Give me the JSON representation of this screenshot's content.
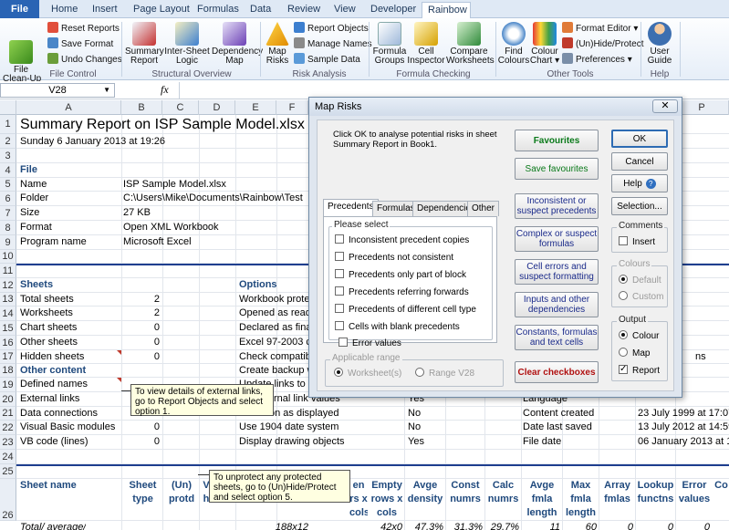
{
  "ribbon": {
    "tabs": [
      "File",
      "Home",
      "Insert",
      "Page Layout",
      "Formulas",
      "Data",
      "Review",
      "View",
      "Developer",
      "Rainbow"
    ],
    "active_tab": "Rainbow",
    "buttons": {
      "file_cleanup": "File\nClean-Up",
      "reset_reports": "Reset Reports",
      "save_format": "Save Format",
      "undo_changes": "Undo Changes",
      "summary_report": "Summary\nReport",
      "inter_sheet": "Inter-Sheet\nLogic",
      "dependency_map": "Dependency\nMap",
      "map_risks": "Map\nRisks",
      "report_objects": "Report Objects",
      "manage_names": "Manage Names",
      "sample_data": "Sample Data",
      "formula_groups": "Formula\nGroups",
      "cell_inspector": "Cell\nInspector",
      "compare_worksheets": "Compare\nWorksheets",
      "find_colours": "Find\nColours",
      "colour_chart": "Colour\nChart",
      "format_editor": "Format Editor",
      "unhide_protect": "(Un)Hide/Protect",
      "preferences": "Preferences",
      "user_guide": "User\nGuide"
    },
    "groups": [
      "File Control",
      "Structural Overview",
      "Risk Analysis",
      "Formula Checking",
      "Other Tools",
      "Help"
    ]
  },
  "formula_bar": {
    "name_box": "V28",
    "fx": "fx",
    "value": ""
  },
  "columns": [
    "A",
    "B",
    "C",
    "D",
    "E",
    "F",
    "G",
    "H",
    "I",
    "J",
    "K",
    "L",
    "M",
    "N",
    "O",
    "P"
  ],
  "rows": {
    "numbers": [
      "1",
      "2",
      "3",
      "4",
      "5",
      "6",
      "7",
      "8",
      "9",
      "10",
      "11",
      "12",
      "13",
      "14",
      "15",
      "16",
      "17",
      "18",
      "19",
      "20",
      "21",
      "22",
      "23",
      "24",
      "25",
      "26"
    ],
    "title": "Summary Report on ISP Sample Model.xlsx",
    "date": "Sunday 6 January 2013 at 19:26",
    "file_label": "File",
    "file_info": [
      {
        "label": "Name",
        "value": "ISP Sample Model.xlsx"
      },
      {
        "label": "Folder",
        "value": "C:\\Users\\Mike\\Documents\\Rainbow\\Test"
      },
      {
        "label": "Size",
        "value": "27 KB"
      },
      {
        "label": "Format",
        "value": "Open XML Workbook"
      },
      {
        "label": "Program name",
        "value": "Microsoft Excel"
      }
    ],
    "sheets_label": "Sheets",
    "options_label": "Options",
    "sheet_counts": [
      {
        "label": "Total sheets",
        "value": "2",
        "option": "Workbook prote"
      },
      {
        "label": "Worksheets",
        "value": "2",
        "option": "Opened as read"
      },
      {
        "label": "Chart sheets",
        "value": "0",
        "option": "Declared as fina"
      },
      {
        "label": "Other sheets",
        "value": "0",
        "option": "Excel 97-2003 c"
      },
      {
        "label": "Hidden sheets",
        "value": "0",
        "option": "Check compatib"
      }
    ],
    "other_content_label": "Other content",
    "backup_option": "Create backup w",
    "other_content": [
      {
        "label": "Defined names",
        "value": "",
        "option": "Update links to",
        "val2": "",
        "label2": "",
        "val3": ""
      },
      {
        "label": "External links",
        "value": "",
        "option": "rnal link values",
        "val2": "Yes",
        "label2": "Language",
        "val3": ""
      },
      {
        "label": "Data connections",
        "value": "0",
        "option": "Precision as displayed",
        "val2": "No",
        "label2": "Content created",
        "val3": "23 July 1999 at 17:07"
      },
      {
        "label": "Visual Basic modules",
        "value": "0",
        "option": "Use 1904 date system",
        "val2": "No",
        "label2": "Date last saved",
        "val3": "13 July 2012 at 14:59"
      },
      {
        "label": "VB code (lines)",
        "value": "0",
        "option": "Display drawing objects",
        "val2": "Yes",
        "label2": "File date",
        "val3": "06 January 2013 at 19"
      }
    ],
    "col_headers": [
      "Sheet name",
      "Sheet\ntype",
      "(Un)\nprotd",
      "V\nh",
      "en\nrs x\ncols",
      "Empty\nrows x\ncols",
      "Avge\ndensity",
      "Const\nnumrs",
      "Calc\nnumrs",
      "Avge\nfmla\nlength",
      "Max\nfmla\nlength",
      "Array\nfmlas",
      "Lookup\nfunctns",
      "Error\nvalues",
      "Co"
    ],
    "total_row": [
      "Total/ average/",
      "188x12",
      "42x0",
      "47.3%",
      "31.3%",
      "29.7%",
      "11",
      "60",
      "0",
      "0",
      "0"
    ],
    "right_tail": "ns"
  },
  "notes": {
    "external_links": "To view details of external links, go to Report Objects and select option 1.",
    "unprotect": "To unprotect any protected sheets, go to (Un)Hide/Protect and select option 5."
  },
  "dialog": {
    "title": "Map Risks",
    "intro": "Click OK to analyse potential risks in sheet Summary Report in Book1.",
    "tabs": [
      "Precedents",
      "Formulas",
      "Dependencies",
      "Other"
    ],
    "please_select": "Please select",
    "checkboxes": [
      "Inconsistent precedent copies",
      "Precedents not consistent",
      "Precedents only part of block",
      "Precedents referring forwards",
      "Precedents of different cell type",
      "Cells with blank precedents",
      "Error values"
    ],
    "applicable_range": "Applicable range",
    "range_worksheet": "Worksheet(s)",
    "range_v28": "Range V28",
    "buttons": {
      "favourites": "Favourites",
      "save_favourites": "Save favourites",
      "inconsistent": "Inconsistent or suspect precedents",
      "complex": "Complex or suspect formulas",
      "cell_errors": "Cell errors and suspect formatting",
      "inputs": "Inputs and other dependencies",
      "constants": "Constants, formulas and text cells",
      "clear": "Clear checkboxes",
      "ok": "OK",
      "cancel": "Cancel",
      "help": "Help",
      "selection": "Selection..."
    },
    "comments_label": "Comments",
    "insert_label": "Insert",
    "colours_label": "Colours",
    "default_label": "Default",
    "custom_label": "Custom",
    "output_label": "Output",
    "output_colour": "Colour",
    "output_map": "Map",
    "output_report": "Report"
  },
  "colors": {
    "accent": "#1f497d",
    "file_tab": "#2a64b4",
    "green": "#0a7a1a",
    "red": "#b01010",
    "note_bg": "#ffffe1"
  }
}
